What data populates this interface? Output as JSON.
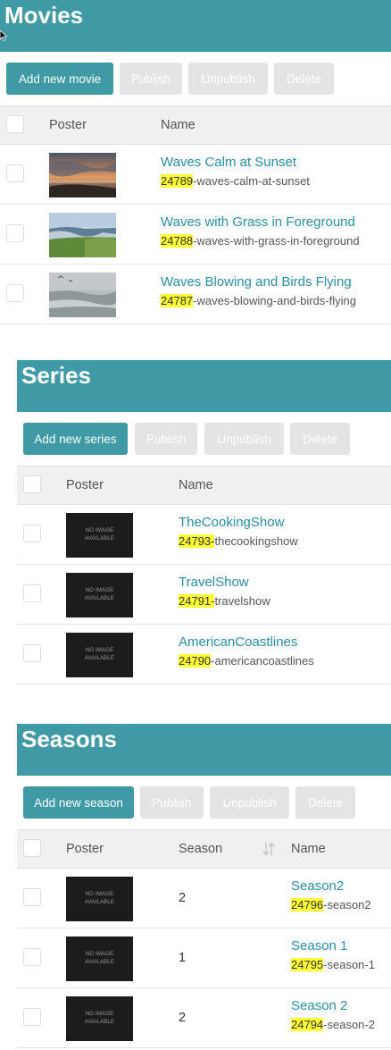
{
  "toolbar": {
    "publish": "Publish",
    "unpublish": "Unpublish",
    "delete": "Delete"
  },
  "columns": {
    "poster": "Poster",
    "name": "Name",
    "season": "Season"
  },
  "no_image": [
    "NO IMAGE",
    "AVAILABLE"
  ],
  "movies": {
    "title": "Movies",
    "add_label": "Add new movie",
    "rows": [
      {
        "name": "Waves Calm at Sunset",
        "id": "24789",
        "slug": "-waves-calm-at-sunset"
      },
      {
        "name": "Waves with Grass in Foreground",
        "id": "24788",
        "slug": "-waves-with-grass-in-foreground"
      },
      {
        "name": "Waves Blowing and Birds Flying",
        "id": "24787",
        "slug": "-waves-blowing-and-birds-flying"
      }
    ]
  },
  "series": {
    "title": "Series",
    "add_label": "Add new series",
    "rows": [
      {
        "name": "TheCookingShow",
        "id": "24793-",
        "slug": "thecookingshow"
      },
      {
        "name": "TravelShow",
        "id": "24791-",
        "slug": "travelshow"
      },
      {
        "name": "AmericanCoastlines",
        "id": "24790",
        "slug": "-americancoastlines"
      }
    ]
  },
  "seasons": {
    "title": "Seasons",
    "add_label": "Add new season",
    "rows": [
      {
        "season": "2",
        "name": "Season2",
        "id": "24796",
        "slug": "-season2"
      },
      {
        "season": "1",
        "name": "Season 1",
        "id": "24795",
        "slug": "-season-1"
      },
      {
        "season": "2",
        "name": "Season 2",
        "id": "24794",
        "slug": "-season-2"
      }
    ]
  },
  "colors": {
    "accent": "#3f9aa6",
    "link": "#2a8fa1",
    "highlight": "#ffff33",
    "disabled_button": "#e4e4e4"
  }
}
